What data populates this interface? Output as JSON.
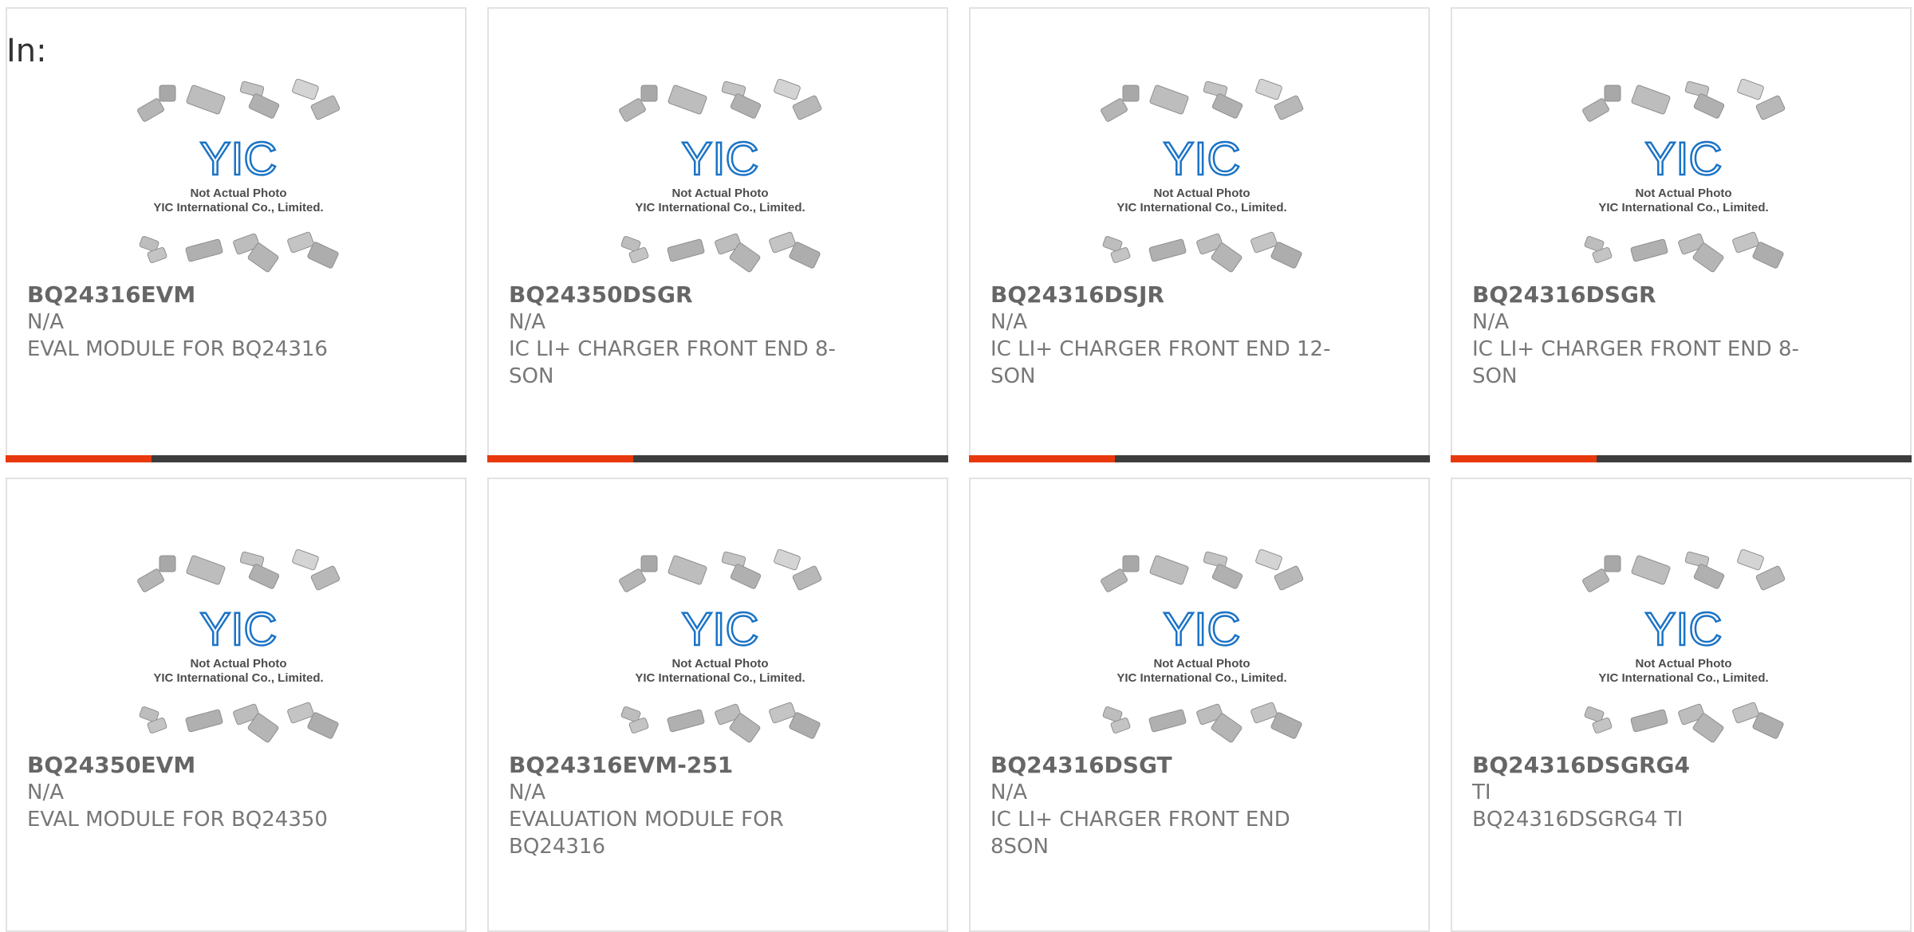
{
  "page": {
    "label": "In:"
  },
  "placeholder": {
    "line1": "Not Actual Photo",
    "line2": "YIC International Co., Limited.",
    "logo_text": "YIC",
    "logo_color": "#1a73c6"
  },
  "colors": {
    "accent": "#e8380d",
    "bar": "#3d3d3d",
    "text": "#777777",
    "title": "#666666"
  },
  "products": [
    {
      "part": "BQ24316EVM",
      "mfr": "N/A",
      "desc": "EVAL MODULE FOR BQ24316"
    },
    {
      "part": "BQ24350DSGR",
      "mfr": "N/A",
      "desc": "IC LI+ CHARGER FRONT END 8-SON"
    },
    {
      "part": "BQ24316DSJR",
      "mfr": "N/A",
      "desc": "IC LI+ CHARGER FRONT END 12-SON"
    },
    {
      "part": "BQ24316DSGR",
      "mfr": "N/A",
      "desc": "IC LI+ CHARGER FRONT END 8-SON"
    },
    {
      "part": "BQ24350EVM",
      "mfr": "N/A",
      "desc": "EVAL MODULE FOR BQ24350"
    },
    {
      "part": "BQ24316EVM-251",
      "mfr": "N/A",
      "desc": "EVALUATION MODULE FOR BQ24316"
    },
    {
      "part": "BQ24316DSGT",
      "mfr": "N/A",
      "desc": "IC LI+ CHARGER FRONT END 8SON"
    },
    {
      "part": "BQ24316DSGRG4",
      "mfr": "TI",
      "desc": "BQ24316DSGRG4 TI"
    }
  ]
}
